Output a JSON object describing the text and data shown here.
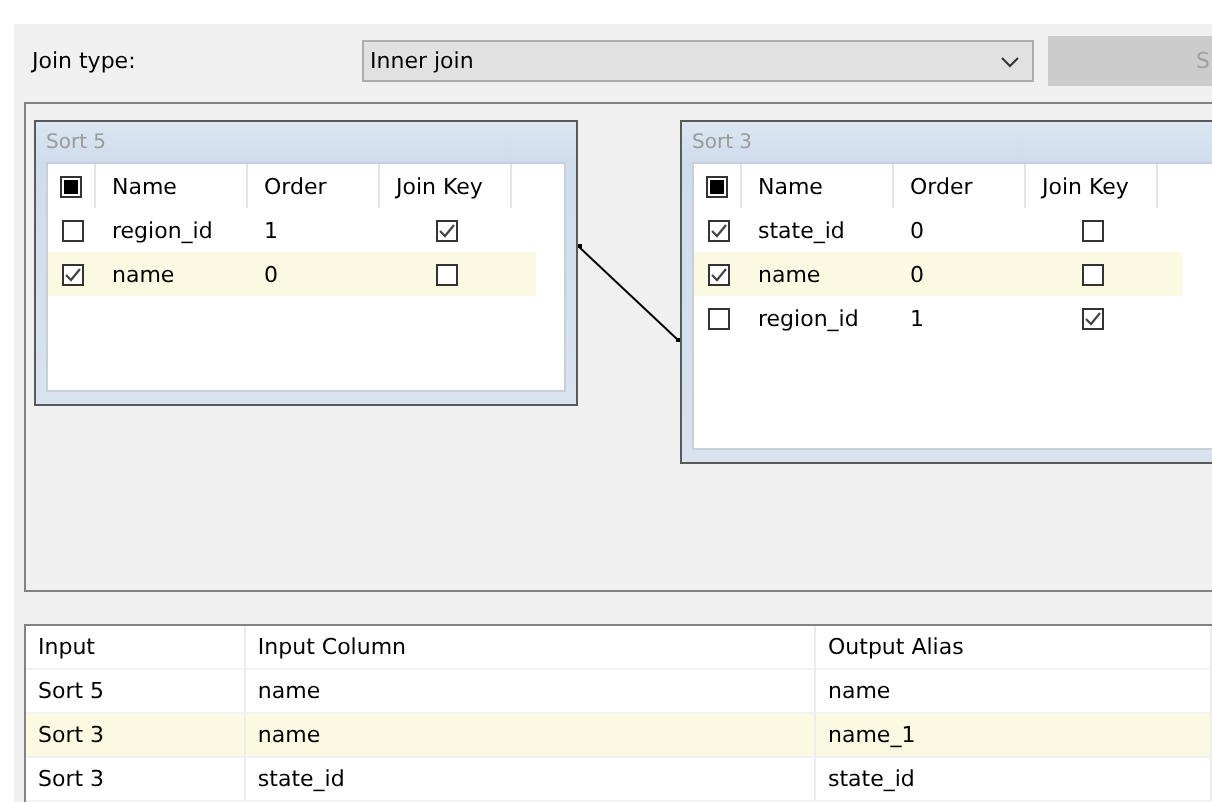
{
  "join_type": {
    "label": "Join type:",
    "value": "Inner join"
  },
  "side_button": {
    "label": "S",
    "disabled": true
  },
  "tables": [
    {
      "title": "Sort 5",
      "select_all_mixed": true,
      "columns": [
        "Name",
        "Order",
        "Join Key"
      ],
      "rows": [
        {
          "checked": false,
          "name": "region_id",
          "order": "1",
          "join_key": true,
          "selected": false
        },
        {
          "checked": true,
          "name": "name",
          "order": "0",
          "join_key": false,
          "selected": true
        }
      ]
    },
    {
      "title": "Sort 3",
      "select_all_mixed": true,
      "columns": [
        "Name",
        "Order",
        "Join Key"
      ],
      "rows": [
        {
          "checked": true,
          "name": "state_id",
          "order": "0",
          "join_key": false,
          "selected": false
        },
        {
          "checked": true,
          "name": "name",
          "order": "0",
          "join_key": false,
          "selected": true
        },
        {
          "checked": false,
          "name": "region_id",
          "order": "1",
          "join_key": true,
          "selected": false
        }
      ]
    }
  ],
  "output_grid": {
    "columns": [
      "Input",
      "Input Column",
      "Output Alias"
    ],
    "rows": [
      {
        "cells": [
          "Sort 5",
          "name",
          "name"
        ],
        "selected": false
      },
      {
        "cells": [
          "Sort 3",
          "name",
          "name_1"
        ],
        "selected": true
      },
      {
        "cells": [
          "Sort 3",
          "state_id",
          "state_id"
        ],
        "selected": false
      }
    ]
  }
}
